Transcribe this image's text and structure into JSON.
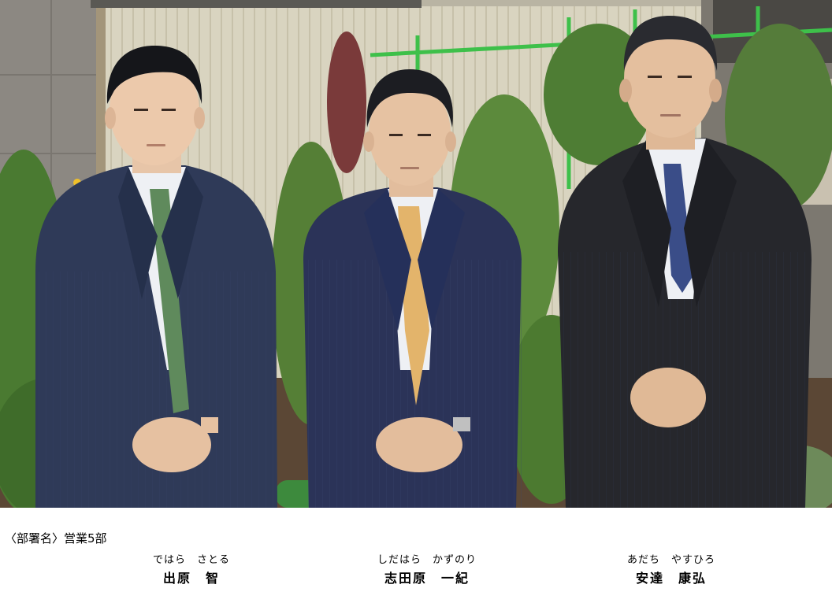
{
  "department": {
    "label": "〈部署名〉",
    "value": "営業5部"
  },
  "people": [
    {
      "reading": "ではら　さとる",
      "name": "出原　智"
    },
    {
      "reading": "しだはら　かずのり",
      "name": "志田原　一紀"
    },
    {
      "reading": "あだち　やすひろ",
      "name": "安達　康弘"
    }
  ],
  "colors": {
    "wall_left": "#8a8680",
    "window_blinds": "#d8d3bf",
    "foliage": "#4f7a36",
    "green_pipe": "#3ec04a",
    "suit_navy": "#2b3450",
    "suit_dark": "#26262b",
    "shirt": "#eef0f4",
    "tie_gold": "#e2b16a",
    "tie_green_stripe": "#4d7a4e",
    "tie_blue_stripe": "#2c3e78",
    "soil": "#5a4634"
  }
}
